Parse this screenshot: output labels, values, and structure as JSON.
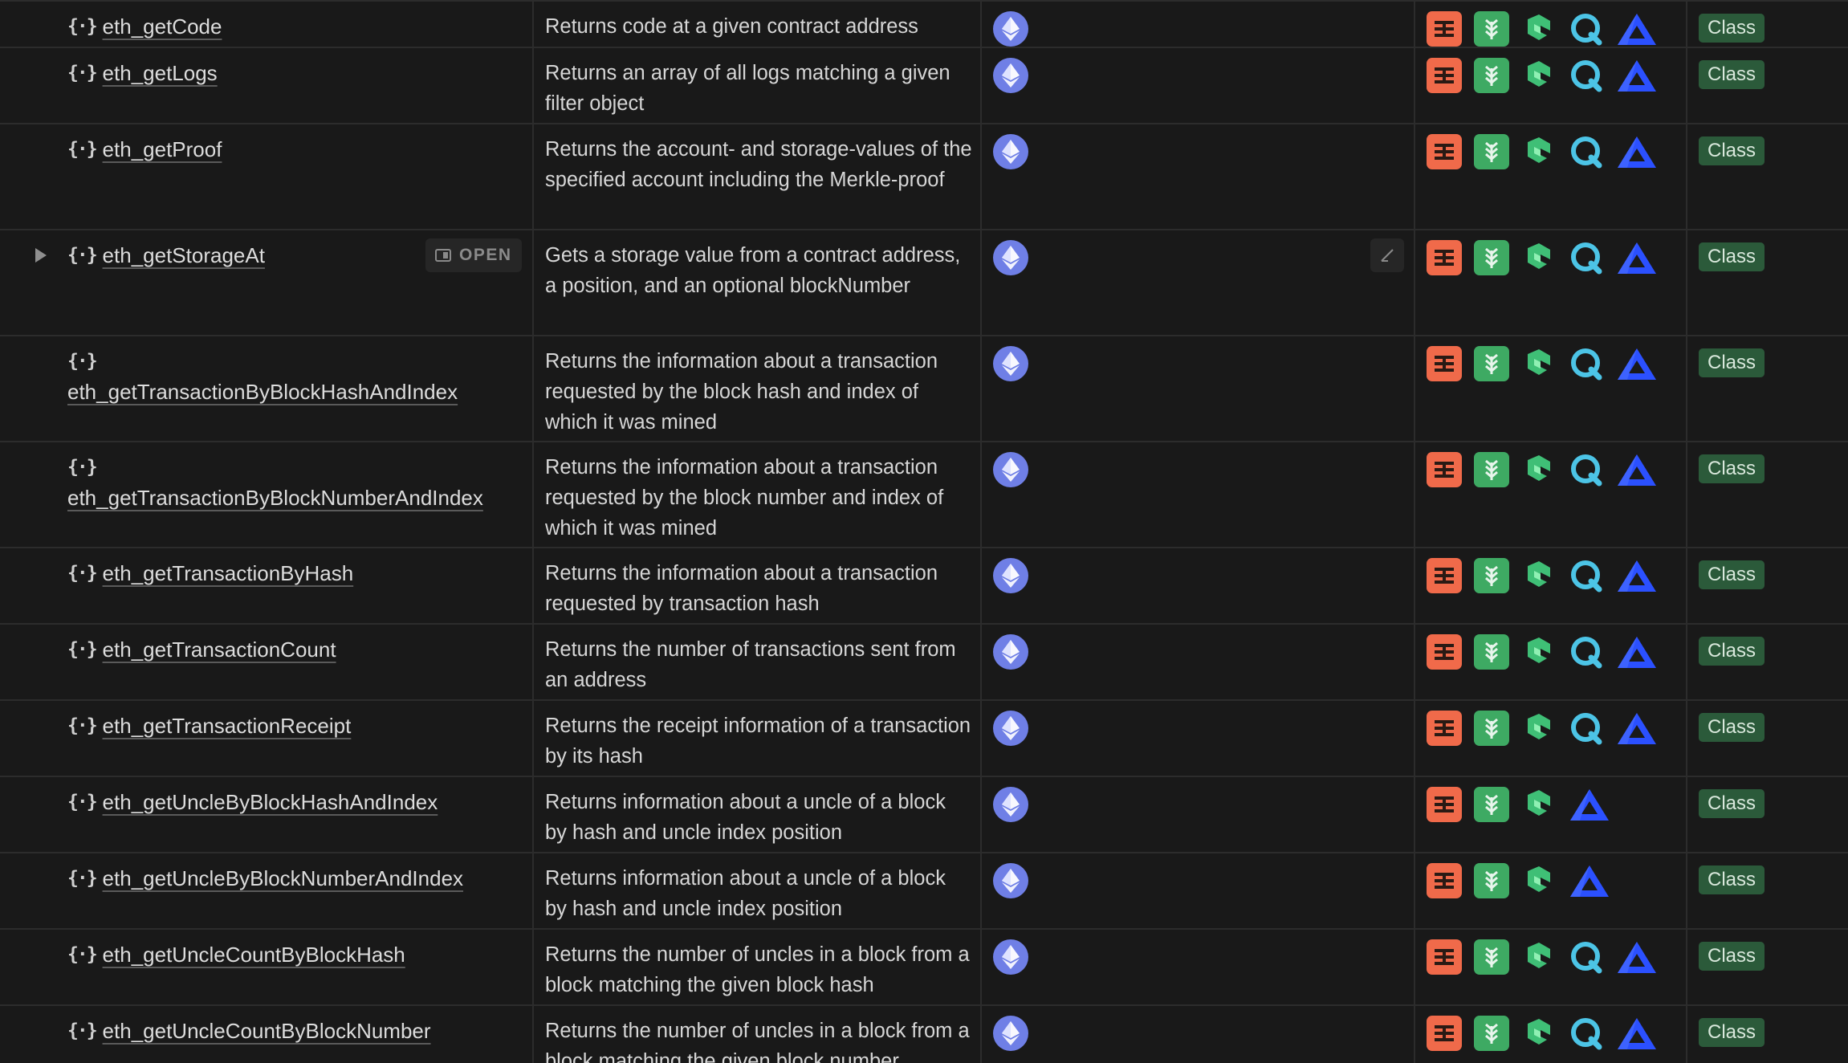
{
  "rows": [
    {
      "name": "eth_getCode",
      "desc": "Returns code at a given contract address",
      "providers": [
        "alchemy",
        "chainstack",
        "getblock",
        "quicknode",
        "ankr"
      ],
      "tag": "Class"
    },
    {
      "name": "eth_getLogs",
      "desc": "Returns an array of all logs matching a given filter object",
      "providers": [
        "alchemy",
        "chainstack",
        "getblock",
        "quicknode",
        "ankr"
      ],
      "tag": "Class"
    },
    {
      "name": "eth_getProof",
      "desc": "Returns the account- and storage-values of the specified account including the Merkle-proof",
      "providers": [
        "alchemy",
        "chainstack",
        "getblock",
        "quicknode",
        "ankr"
      ],
      "tag": "Class"
    },
    {
      "name": "eth_getStorageAt",
      "desc": "Gets a storage value from a contract address, a position, and an optional blockNumber",
      "providers": [
        "alchemy",
        "chainstack",
        "getblock",
        "quicknode",
        "ankr"
      ],
      "tag": "Class",
      "open_label": "OPEN"
    },
    {
      "name": "eth_getTransactionByBlockHashAndIndex",
      "desc": "Returns the information about a transaction requested by the block hash and index of which it was mined",
      "providers": [
        "alchemy",
        "chainstack",
        "getblock",
        "quicknode",
        "ankr"
      ],
      "tag": "Class"
    },
    {
      "name": "eth_getTransactionByBlockNumberAndIndex",
      "desc": "Returns the information about a transaction requested by the block number and index of which it was mined",
      "providers": [
        "alchemy",
        "chainstack",
        "getblock",
        "quicknode",
        "ankr"
      ],
      "tag": "Class"
    },
    {
      "name": "eth_getTransactionByHash",
      "desc": "Returns the information about a transaction requested by transaction hash",
      "providers": [
        "alchemy",
        "chainstack",
        "getblock",
        "quicknode",
        "ankr"
      ],
      "tag": "Class"
    },
    {
      "name": "eth_getTransactionCount",
      "desc": "Returns the number of transactions sent from an address",
      "providers": [
        "alchemy",
        "chainstack",
        "getblock",
        "quicknode",
        "ankr"
      ],
      "tag": "Class"
    },
    {
      "name": "eth_getTransactionReceipt",
      "desc": "Returns the receipt information of a transaction by its hash",
      "providers": [
        "alchemy",
        "chainstack",
        "getblock",
        "quicknode",
        "ankr"
      ],
      "tag": "Class"
    },
    {
      "name": "eth_getUncleByBlockHashAndIndex",
      "desc": "Returns information about a uncle of a block by hash and uncle index position",
      "providers": [
        "alchemy",
        "chainstack",
        "getblock",
        "ankr"
      ],
      "tag": "Class"
    },
    {
      "name": "eth_getUncleByBlockNumberAndIndex",
      "desc": "Returns information about a uncle of a block by hash and uncle index position",
      "providers": [
        "alchemy",
        "chainstack",
        "getblock",
        "ankr"
      ],
      "tag": "Class"
    },
    {
      "name": "eth_getUncleCountByBlockHash",
      "desc": "Returns the number of uncles in a block from a block matching the given block hash",
      "providers": [
        "alchemy",
        "chainstack",
        "getblock",
        "quicknode",
        "ankr"
      ],
      "tag": "Class"
    },
    {
      "name": "eth_getUncleCountByBlockNumber",
      "desc": "Returns the number of uncles in a block from a block matching the given block number",
      "providers": [
        "alchemy",
        "chainstack",
        "getblock",
        "quicknode",
        "ankr"
      ],
      "tag": "Class"
    }
  ]
}
